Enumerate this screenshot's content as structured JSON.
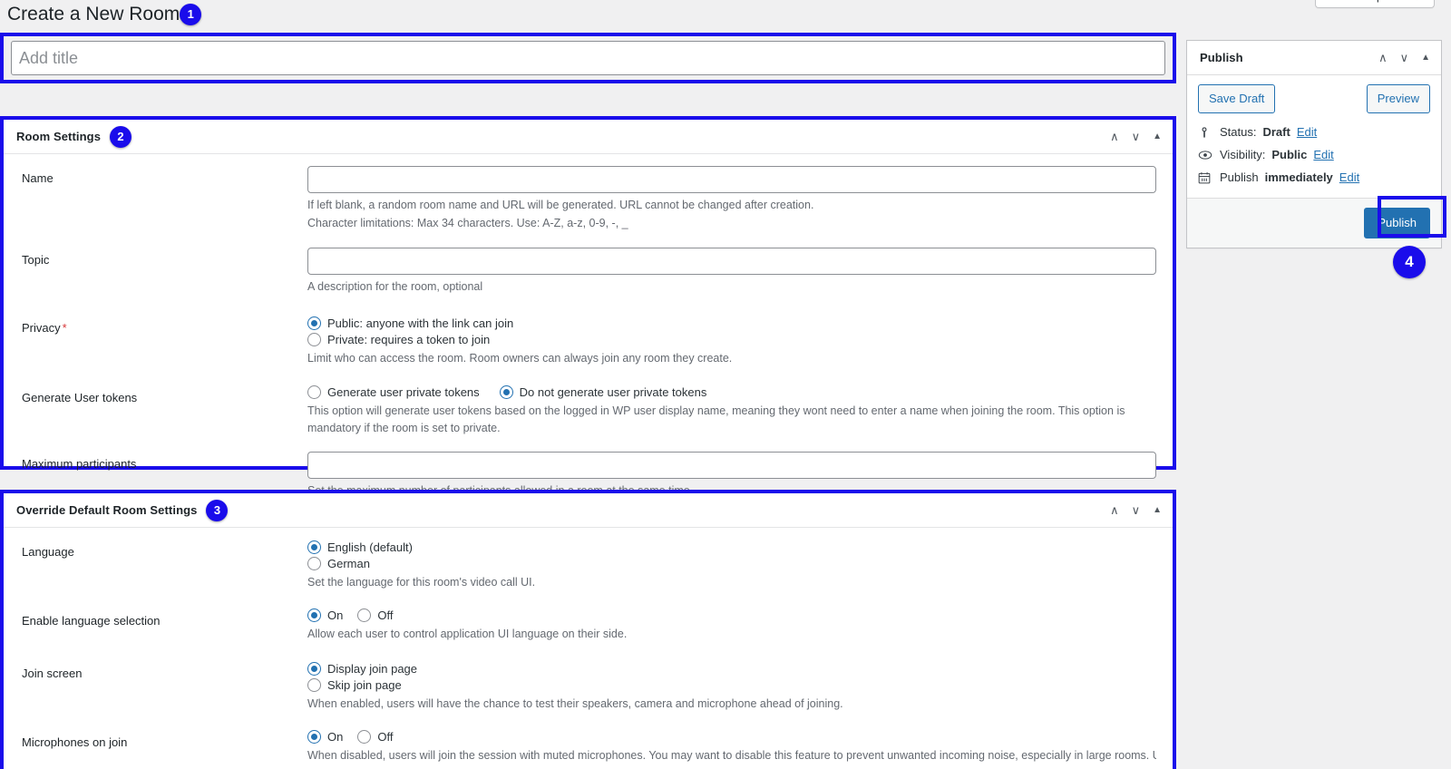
{
  "header": {
    "screen_options": "Screen Options ▼",
    "page_title": "Create a New Room",
    "badge_1": "1"
  },
  "title_field": {
    "placeholder": "Add title",
    "value": ""
  },
  "room_settings": {
    "panel_title": "Room Settings",
    "badge": "2",
    "controls": {
      "up": "∧",
      "down": "∨",
      "toggle": "▲"
    },
    "fields": {
      "name": {
        "label": "Name",
        "value": "",
        "hint_1": "If left blank, a random room name and URL will be generated. URL cannot be changed after creation.",
        "hint_2": "Character limitations: Max 34 characters. Use: A-Z, a-z, 0-9, -, _"
      },
      "topic": {
        "label": "Topic",
        "value": "",
        "hint": "A description for the room, optional"
      },
      "privacy": {
        "label": "Privacy",
        "required_mark": "*",
        "options": [
          {
            "label": "Public: anyone with the link can join",
            "selected": true
          },
          {
            "label": "Private: requires a token to join",
            "selected": false
          }
        ],
        "hint": "Limit who can access the room. Room owners can always join any room they create."
      },
      "generate_user_tokens": {
        "label": "Generate User tokens",
        "options": [
          {
            "label": "Generate user private tokens",
            "selected": false
          },
          {
            "label": "Do not generate user private tokens",
            "selected": true
          }
        ],
        "hint": "This option will generate user tokens based on the logged in WP user display name, meaning they wont need to enter a name when joining the room. This option is mandatory if the room is set to private."
      },
      "maximum_participants": {
        "label": "Maximum participants",
        "value": "",
        "hint": "Set the maximum number of participants allowed in a room at the same time."
      }
    }
  },
  "override_settings": {
    "panel_title": "Override Default Room Settings",
    "badge": "3",
    "controls": {
      "up": "∧",
      "down": "∨",
      "toggle": "▲"
    },
    "fields": {
      "language": {
        "label": "Language",
        "options": [
          {
            "label": "English (default)",
            "selected": true
          },
          {
            "label": "German",
            "selected": false
          }
        ],
        "hint": "Set the language for this room's video call UI."
      },
      "enable_language_selection": {
        "label": "Enable language selection",
        "options": [
          {
            "label": "On",
            "selected": true
          },
          {
            "label": "Off",
            "selected": false
          }
        ],
        "hint": "Allow each user to control application UI language on their side."
      },
      "join_screen": {
        "label": "Join screen",
        "options": [
          {
            "label": "Display join page",
            "selected": true
          },
          {
            "label": "Skip join page",
            "selected": false
          }
        ],
        "hint": "When enabled, users will have the chance to test their speakers, camera and microphone ahead of joining."
      },
      "microphones_on_join": {
        "label": "Microphones on join",
        "options": [
          {
            "label": "On",
            "selected": true
          },
          {
            "label": "Off",
            "selected": false
          }
        ],
        "hint": "When disabled, users will join the session with muted microphones. You may want to disable this feature to prevent unwanted incoming noise, especially in large rooms. Users will,"
      }
    }
  },
  "publish": {
    "panel_title": "Publish",
    "controls": {
      "up": "∧",
      "down": "∨",
      "toggle": "▲"
    },
    "save_draft": "Save Draft",
    "preview": "Preview",
    "status": {
      "prefix": "Status:",
      "value": "Draft",
      "edit": "Edit"
    },
    "visibility": {
      "prefix": "Visibility:",
      "value": "Public",
      "edit": "Edit"
    },
    "schedule": {
      "prefix": "Publish",
      "value": "immediately",
      "edit": "Edit"
    },
    "publish_button": "Publish",
    "badge_4": "4"
  },
  "colors": {
    "highlight": "#1a0ceb",
    "accent": "#2271b1",
    "required": "#d63638",
    "page_bg": "#f0f0f1"
  }
}
